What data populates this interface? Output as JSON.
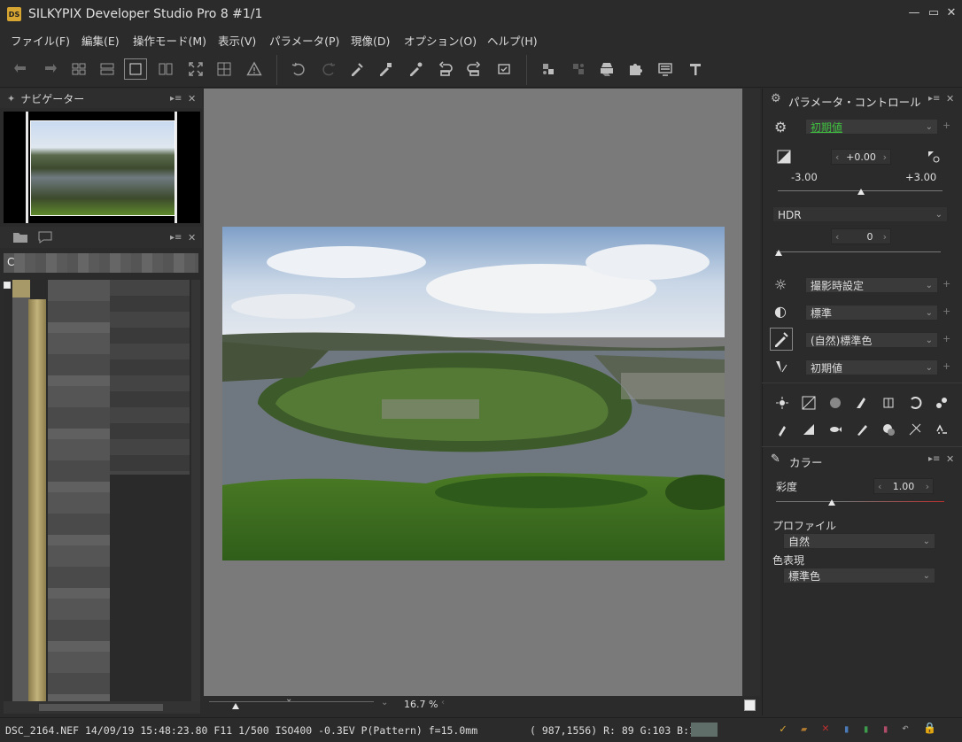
{
  "window": {
    "logo_text": "DS",
    "title": "SILKYPIX Developer Studio Pro 8   #1/1",
    "minimize": "—",
    "maximize": "▭",
    "close": "✕"
  },
  "menu": [
    "ファイル(F)",
    "編集(E)",
    "操作モード(M)",
    "表示(V)",
    "パラメータ(P)",
    "現像(D)",
    "オプション(O)",
    "ヘルプ(H)"
  ],
  "toolbar": {
    "icons": [
      "back-arrow-icon",
      "forward-arrow-icon",
      "grid-large-icon",
      "grid-wide-icon",
      "single-view-icon",
      "compare-view-icon",
      "fit-screen-icon",
      "crop-grid-icon",
      "warning-icon",
      "undo-icon",
      "redo-icon",
      "paste-params-icon",
      "copy-params-icon",
      "eyedropper-icon",
      "rotate-left-icon",
      "rotate-right-icon",
      "checkmark-icon",
      "develop-icon",
      "batch-develop-icon",
      "printer-icon",
      "puzzle-icon",
      "monitor-icon",
      "hammer-icon"
    ]
  },
  "navigator": {
    "title": "ナビゲーター"
  },
  "browser": {
    "path_text": "C"
  },
  "preview": {
    "zoom_value": "16.7",
    "zoom_unit": "%"
  },
  "params": {
    "title": "パラメータ・コントロール",
    "preset_value": "初期値",
    "exposure_value": "+0.00",
    "exposure_min": "-3.00",
    "exposure_max": "+3.00",
    "hdr_value": "HDR",
    "hdr_spin": "0",
    "white_balance": "撮影時設定",
    "tone": "標準",
    "color_mode": "(自然)標準色",
    "sharpness": "初期値"
  },
  "color_panel": {
    "title": "カラー",
    "saturation_label": "彩度",
    "saturation_value": "1.00",
    "profile_label": "プロファイル",
    "profile_value": "自然",
    "color_expression_label": "色表現",
    "color_expression_value": "標準色"
  },
  "status": {
    "file_info": "DSC_2164.NEF 14/09/19 15:48:23.80 F11 1/500 ISO400 -0.3EV P(Pattern) f=15.0mm",
    "pixel_info": "( 987,1556) R: 89 G:103 B:101",
    "swatch_color": "#5f6e68"
  },
  "colors": {
    "accent": "#d7a531",
    "preset_green": "#3fbf3f",
    "slider_red": "#c03030"
  }
}
